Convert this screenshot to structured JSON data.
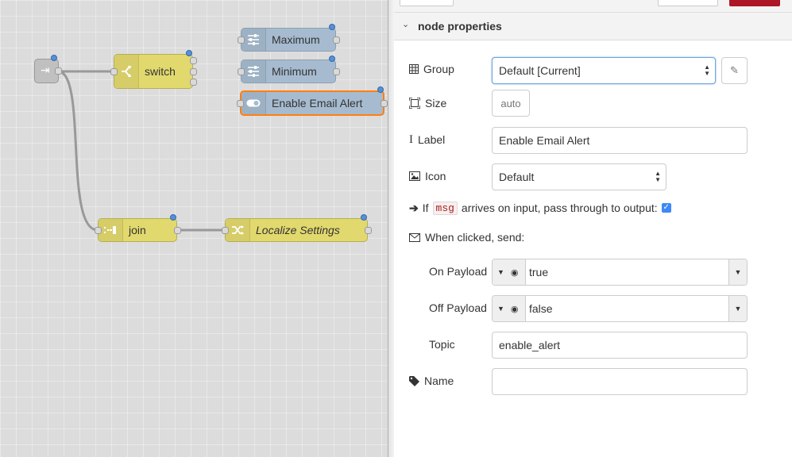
{
  "workspace": {
    "nodes": {
      "inject_label": "",
      "switch_label": "switch",
      "maximum_label": "Maximum",
      "minimum_label": "Minimum",
      "email_alert_label": "Enable Email Alert",
      "join_label": "join",
      "localize_label": "Localize Settings"
    }
  },
  "panel": {
    "section_title": "node properties",
    "group": {
      "label": "Group",
      "value": "Default [Current]"
    },
    "size": {
      "label": "Size",
      "value": "auto"
    },
    "label_field": {
      "label": "Label",
      "value": "Enable Email Alert"
    },
    "icon": {
      "label": "Icon",
      "value": "Default"
    },
    "passthrough": {
      "prefix": "If",
      "code": "msg",
      "suffix": "arrives on input, pass through to output:",
      "checked": true,
      "check_glyph": "✓"
    },
    "when_clicked": {
      "label": "When clicked, send:"
    },
    "on_payload": {
      "label": "On Payload",
      "value": "true"
    },
    "off_payload": {
      "label": "Off Payload",
      "value": "false"
    },
    "topic": {
      "label": "Topic",
      "value": "enable_alert"
    },
    "name": {
      "label": "Name",
      "value": ""
    }
  },
  "colors": {
    "function_node": "#e2d96e",
    "dashboard_node": "#a6bbcf",
    "selection": "#ff7f0e",
    "accent_blue": "#3d8af7",
    "delete_red": "#ad1625"
  }
}
